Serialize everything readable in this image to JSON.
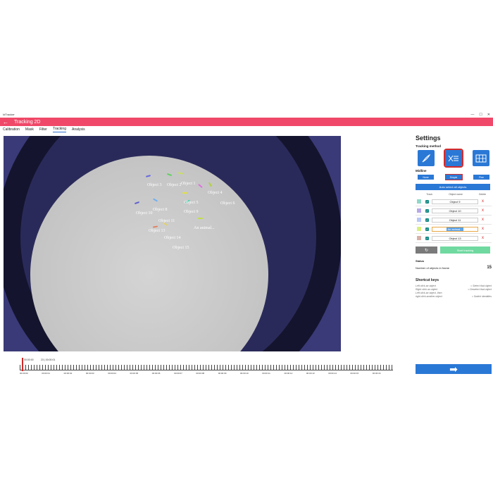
{
  "window": {
    "title": "IdTracker",
    "controls": [
      "—",
      "☐",
      "✕"
    ]
  },
  "header": {
    "back_icon": "arrow-left-icon",
    "title": "Tracking 2D"
  },
  "tabs": [
    {
      "label": "Calibration"
    },
    {
      "label": "Mask"
    },
    {
      "label": "Filter"
    },
    {
      "label": "Tracking",
      "active": true
    },
    {
      "label": "Analysis"
    }
  ],
  "objects": [
    {
      "label": "Object 3",
      "color": "#d8d8ff"
    },
    {
      "label": "Object 2",
      "color": "#d8ffd8"
    },
    {
      "label": "Object 1",
      "color": "#ffffff"
    },
    {
      "label": "Object 4",
      "color": "#ffd8ff"
    },
    {
      "label": "Object 5",
      "color": "#eaffd8"
    },
    {
      "label": "Object 6",
      "color": "#ffd8c8"
    },
    {
      "label": "Object 10",
      "color": "#d0d0ff"
    },
    {
      "label": "Object 8",
      "color": "#d8f0ff"
    },
    {
      "label": "Object 9",
      "color": "#d8fff0"
    },
    {
      "label": "Object 11",
      "color": "#e0e0ff"
    },
    {
      "label": "An animal...",
      "color": "#f0ffb0"
    },
    {
      "label": "Object 13",
      "color": "#ffd8d8"
    },
    {
      "label": "Object 14",
      "color": "#fff0d8"
    },
    {
      "label": "Object 15",
      "color": "#ffd0e0"
    }
  ],
  "settings": {
    "title": "Settings",
    "tracking_method_label": "Tracking method",
    "methods": [
      {
        "icon": "feather-icon"
      },
      {
        "icon": "split-paths-icon",
        "selected": true
      },
      {
        "icon": "grid-icon"
      }
    ],
    "midline_label": "Midline",
    "midline_options": [
      {
        "label": "None"
      },
      {
        "label": "Simple",
        "selected": true
      },
      {
        "label": "Fine"
      }
    ],
    "auto_select_label": "Auto select all objects",
    "table_headers": {
      "track": "Track",
      "name": "Object name",
      "delete": "Delete"
    },
    "rows": [
      {
        "color": "#8fd8c8",
        "name": "Object 9"
      },
      {
        "color": "#b8a8e8",
        "name": "Object 10"
      },
      {
        "color": "#b8c8f8",
        "name": "Object 11"
      },
      {
        "color": "#d8f080",
        "name": "An animal...",
        "editing": true
      },
      {
        "color": "#d8b0a8",
        "name": "Object 13"
      }
    ],
    "delete_glyph": "x",
    "check_glyph": "✓",
    "reset_icon": "refresh-icon",
    "start_label": "Start tracking",
    "status_label": "Status",
    "objects_in_frame_label": "Number of objects in frame",
    "objects_in_frame_value": "15",
    "shortcut_title": "Shortcut keys",
    "shortcuts": [
      {
        "key": "Left click an object",
        "action": "= Select that object"
      },
      {
        "key": "Right click an object",
        "action": "= Deselect that object"
      },
      {
        "key": "Left click an object, then",
        "action": ""
      },
      {
        "key": "right click another object",
        "action": "= Switch identities"
      }
    ]
  },
  "timeline": {
    "frame_start": "00:00:00",
    "frame_current": "23 | 00:00:01",
    "labels": [
      "00:00:00",
      "00:00:01",
      "00:00:02",
      "00:00:03",
      "00:00:04",
      "00:00:05",
      "00:00:06",
      "00:00:07",
      "00:00:08",
      "00:00:09",
      "00:00:10",
      "00:00:11",
      "00:00:12",
      "00:00:13",
      "00:00:14",
      "00:00:15",
      "00:00:16"
    ]
  },
  "next_button": {
    "icon": "arrow-right-icon",
    "glyph": "➡"
  }
}
